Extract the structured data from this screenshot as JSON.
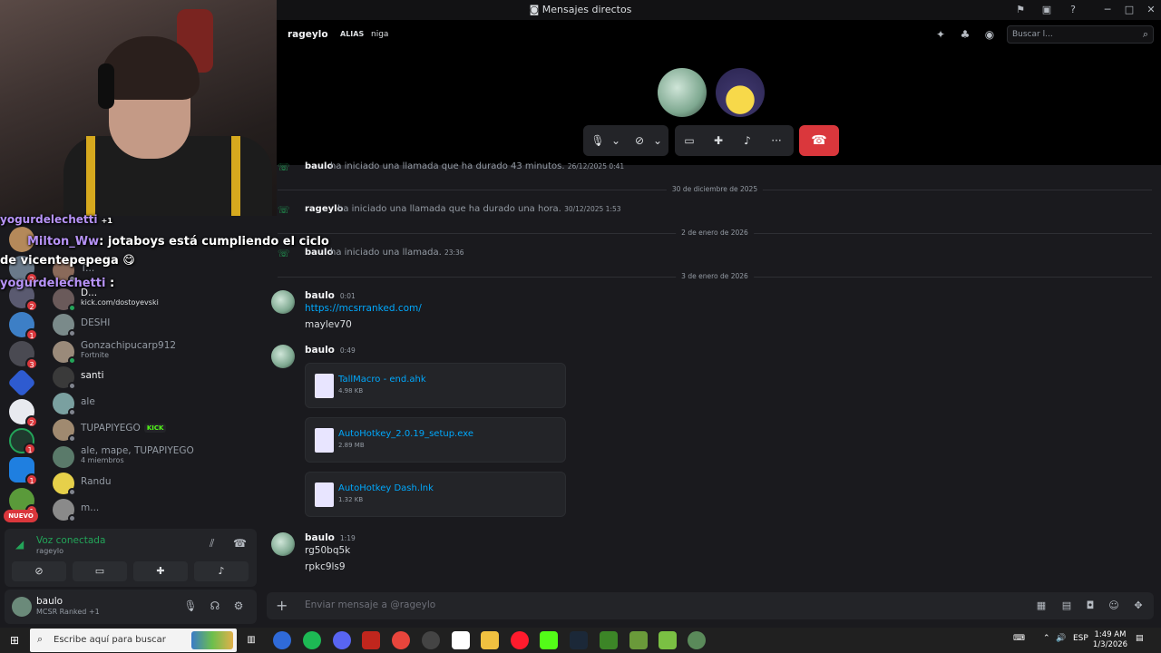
{
  "window": {
    "title": "Mensajes directos"
  },
  "overlay": {
    "line1_name": "yogurdelechetti",
    "line1_extra": "+1",
    "line2_name": "Milton_Ww",
    "line2_text": ": jotaboys está cumpliendo el ciclo",
    "line3_text": "de vicentepepega",
    "line4_name": "yogurdelechetti",
    "line4_text": ":"
  },
  "servers": {
    "badges": [
      "2",
      "2",
      "1",
      "3",
      "2",
      "2",
      "1",
      "1",
      "1"
    ],
    "nuevo": "NUEVO"
  },
  "dms": [
    {
      "name": "T..."
    },
    {
      "name": "D...",
      "sub": "kick.com/dostoyevski"
    },
    {
      "name": "DESHI"
    },
    {
      "name": "Gonzachipucarp912",
      "sub": "Fortnite"
    },
    {
      "name": "santi"
    },
    {
      "name": "ale"
    },
    {
      "name": "TUPAPIYEGO",
      "tag": "KICK"
    },
    {
      "name": "ale, mape, TUPAPIYEGO",
      "sub": "4 miembros"
    },
    {
      "name": "Randu"
    },
    {
      "name": "m..."
    }
  ],
  "voice": {
    "status": "Voz conectada",
    "channel": "rageylo"
  },
  "user": {
    "name": "baulo",
    "status": "MCSR Ranked +1"
  },
  "header": {
    "name": "rageylo",
    "alias_label": "ALIAS",
    "alias_value": "niga",
    "search_placeholder": "Buscar l..."
  },
  "messages": {
    "sys1": {
      "who": "baulo",
      "text": "ha iniciado una llamada que ha durado 43 minutos.",
      "ts": "26/12/2025 0:41"
    },
    "div1": "30 de diciembre de 2025",
    "sys2": {
      "who": "rageylo",
      "text": "ha iniciado una llamada que ha durado una hora.",
      "ts": "30/12/2025 1:53"
    },
    "div2": "2 de enero de 2026",
    "sys3": {
      "who": "baulo",
      "text": "ha iniciado una llamada.",
      "ts": "23:36"
    },
    "div3": "3 de enero de 2026",
    "m1": {
      "author": "baulo",
      "ts": "0:01",
      "link": "https://mcsrranked.com/",
      "text": "maylev70"
    },
    "m2": {
      "author": "baulo",
      "ts": "0:49",
      "files": [
        {
          "name": "TallMacro - end.ahk",
          "size": "4.98 KB"
        },
        {
          "name": "AutoHotkey_2.0.19_setup.exe",
          "size": "2.89 MB"
        },
        {
          "name": "AutoHotkey Dash.lnk",
          "size": "1.32 KB"
        }
      ]
    },
    "m3": {
      "author": "baulo",
      "ts": "1:19",
      "line1": "rg50bq5k",
      "line2": "rpkc9ls9"
    }
  },
  "composer": {
    "placeholder": "Enviar mensaje a @rageylo"
  },
  "taskbar": {
    "search_placeholder": "Escribe aquí para buscar",
    "lang": "ESP",
    "time": "1:49 AM",
    "date": "1/3/2026"
  },
  "colors": {
    "accent_green": "#23a559",
    "danger": "#da373c",
    "link": "#00a8fc"
  }
}
